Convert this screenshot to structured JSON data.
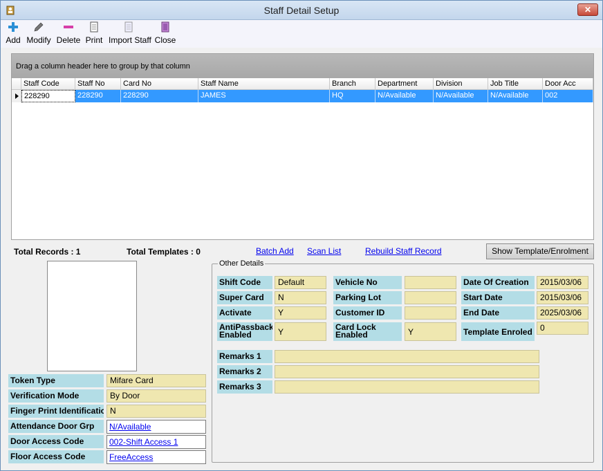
{
  "window": {
    "title": "Staff Detail Setup",
    "close_symbol": "✕"
  },
  "toolbar": {
    "add": "Add",
    "modify": "Modify",
    "delete": "Delete",
    "print": "Print",
    "import_staff": "Import Staff",
    "close": "Close"
  },
  "grid": {
    "group_hint": "Drag a column header here to group by that column",
    "columns": [
      "Staff Code",
      "Staff No",
      "Card No",
      "Staff Name",
      "Branch",
      "Department",
      "Division",
      "Job Title",
      "Door Acc"
    ],
    "rows": [
      [
        "228290",
        "228290",
        "228290",
        "JAMES",
        "HQ",
        "N/Available",
        "N/Available",
        "N/Available",
        "002"
      ]
    ]
  },
  "summary": {
    "total_records": "Total Records : 1",
    "total_templates": "Total Templates : 0",
    "batch_add": "Batch Add",
    "scan_list": "Scan List",
    "rebuild": "Rebuild Staff Record",
    "show_template": "Show Template/Enrolment"
  },
  "left": {
    "token_type": {
      "label": "Token Type",
      "value": "Mifare Card"
    },
    "verification_mode": {
      "label": "Verification Mode",
      "value": "By Door"
    },
    "finger_print": {
      "label": "Finger Print Identification",
      "value": "N"
    },
    "attendance_door": {
      "label": "Attendance Door Grp",
      "value": "N/Available"
    },
    "door_access": {
      "label": "Door Access Code",
      "value": "002-Shift Access 1"
    },
    "floor_access": {
      "label": "Floor Access Code",
      "value": "FreeAccess"
    }
  },
  "other": {
    "title": "Other Details",
    "shift_code": {
      "label": "Shift Code",
      "value": "Default"
    },
    "super_card": {
      "label": "Super Card",
      "value": "N"
    },
    "activate": {
      "label": "Activate",
      "value": "Y"
    },
    "anti_passback": {
      "label_1": "AntiPassback",
      "label_2": "Enabled",
      "value": "Y"
    },
    "vehicle_no": {
      "label": "Vehicle No",
      "value": ""
    },
    "parking_lot": {
      "label": "Parking Lot",
      "value": ""
    },
    "customer_id": {
      "label": "Customer ID",
      "value": ""
    },
    "card_lock": {
      "label_1": "Card Lock",
      "label_2": "Enabled",
      "value": "Y"
    },
    "date_creation": {
      "label": "Date Of Creation",
      "value": "2015/03/06"
    },
    "start_date": {
      "label": "Start Date",
      "value": "2015/03/06"
    },
    "end_date": {
      "label": "End Date",
      "value": "2025/03/06"
    },
    "template_enroled": {
      "label": "Template Enroled",
      "value": "0"
    },
    "remarks_1": {
      "label": "Remarks 1",
      "value": ""
    },
    "remarks_2": {
      "label": "Remarks 2",
      "value": ""
    },
    "remarks_3": {
      "label": "Remarks 3",
      "value": ""
    }
  }
}
